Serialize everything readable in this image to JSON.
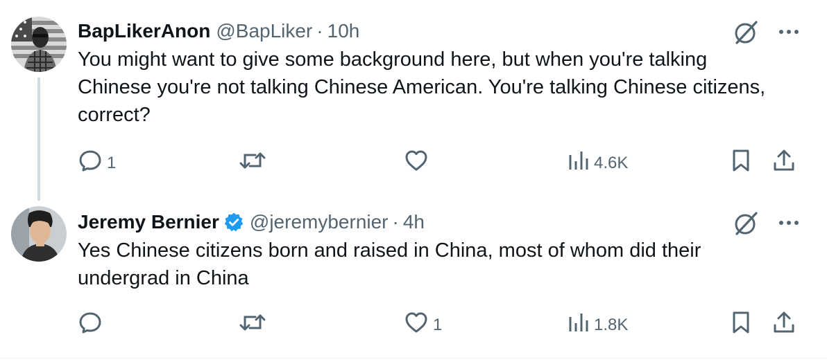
{
  "posts": [
    {
      "author_name": "BapLikerAnon",
      "handle": "@BapLiker",
      "separator": "·",
      "time": "10h",
      "verified": false,
      "text": "You might want to give some background here, but when you're talking Chinese you're not talking Chinese American. You're talking Chinese citizens, correct?",
      "replies": "1",
      "reposts": "",
      "likes": "",
      "views": "4.6K",
      "avatar_icon": "avatar-person-flag-background"
    },
    {
      "author_name": "Jeremy Bernier",
      "handle": "@jeremybernier",
      "separator": "·",
      "time": "4h",
      "verified": true,
      "text": "Yes Chinese citizens born and raised in China, most of whom did their undergrad in China",
      "replies": "",
      "reposts": "",
      "likes": "1",
      "views": "1.8K",
      "avatar_icon": "avatar-person-photo"
    }
  ],
  "icons": {
    "reply": "reply-icon",
    "repost": "repost-icon",
    "like": "heart-icon",
    "views": "views-bar-chart-icon",
    "bookmark": "bookmark-icon",
    "share": "share-icon",
    "grok": "grok-slash-icon",
    "more": "more-dots-icon",
    "verified": "verified-badge-icon"
  },
  "colors": {
    "text_primary": "#0f1419",
    "text_secondary": "#536471",
    "verified_blue": "#1d9bf0",
    "thread_line": "#cfd9de"
  }
}
